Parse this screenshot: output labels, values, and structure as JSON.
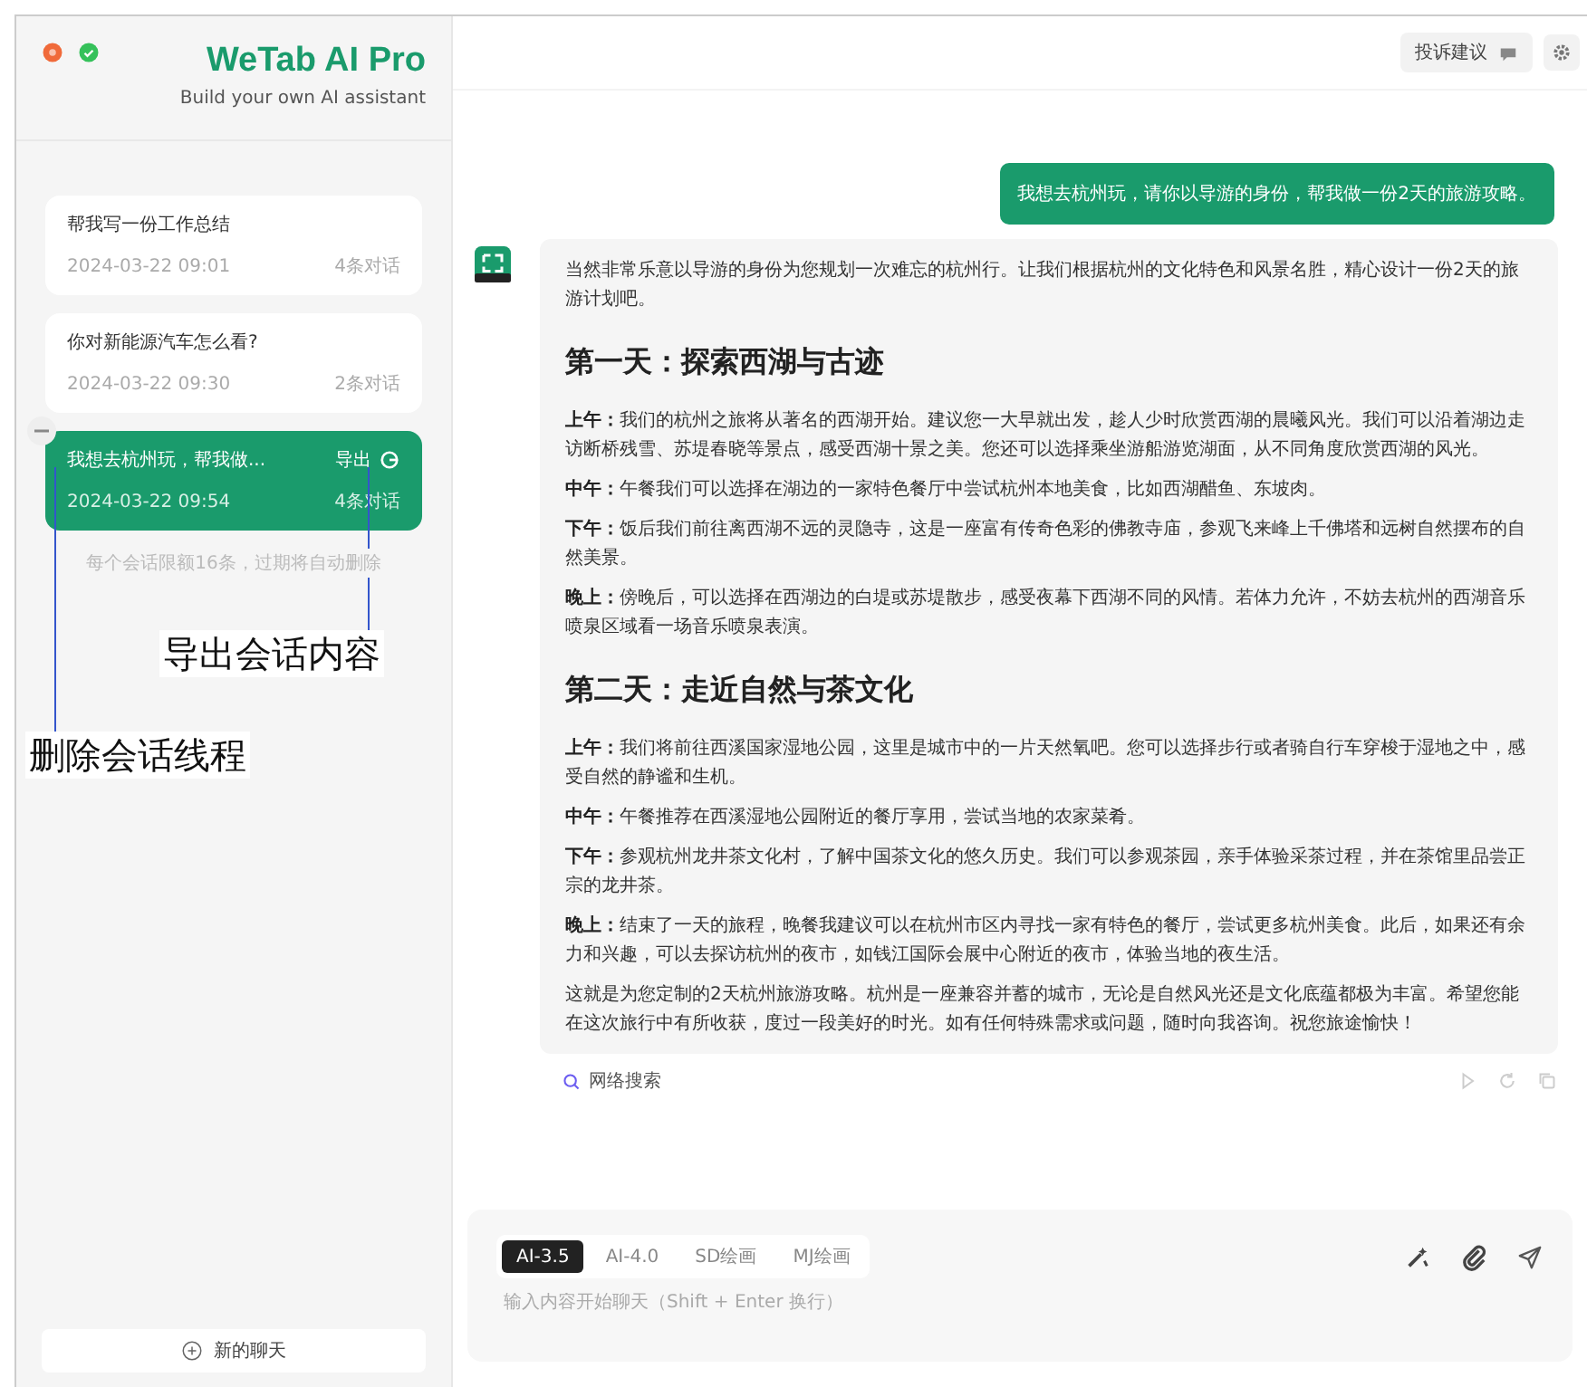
{
  "app": {
    "title": "WeTab AI Pro",
    "subtitle": "Build your own AI assistant"
  },
  "conversations": [
    {
      "title": "帮我写一份工作总结",
      "time": "2024-03-22 09:01",
      "count": "4条对话",
      "selected": false
    },
    {
      "title": "你对新能源汽车怎么看?",
      "time": "2024-03-22 09:30",
      "count": "2条对话",
      "selected": false
    },
    {
      "title": "我想去杭州玩，帮我做...",
      "time": "2024-03-22 09:54",
      "count": "4条对话",
      "selected": true,
      "export_label": "导出"
    }
  ],
  "limit_note": "每个会话限额16条，过期将自动删除",
  "new_chat": "新的聊天",
  "feedback_button": "投诉建议",
  "user_message": "我想去杭州玩，请你以导游的身份，帮我做一份2天的旅游攻略。",
  "answer": [
    {
      "kind": "text",
      "text": "当然非常乐意以导游的身份为您规划一次难忘的杭州行。让我们根据杭州的文化特色和风景名胜，精心设计一份2天的旅游计划吧。"
    },
    {
      "kind": "heading",
      "text": "第一天：探索西湖与古迹"
    },
    {
      "kind": "text",
      "text": "**上午：**我们的杭州之旅将从著名的西湖开始。建议您一大早就出发，趁人少时欣赏西湖的晨曦风光。我们可以沿着湖边走访断桥残雪、苏堤春晓等景点，感受西湖十景之美。您还可以选择乘坐游船游览湖面，从不同角度欣赏西湖的风光。"
    },
    {
      "kind": "text",
      "text": "**中午：**午餐我们可以选择在湖边的一家特色餐厅中尝试杭州本地美食，比如西湖醋鱼、东坡肉。"
    },
    {
      "kind": "text",
      "text": "**下午：**饭后我们前往离西湖不远的灵隐寺，这是一座富有传奇色彩的佛教寺庙，参观飞来峰上千佛塔和远树自然摆布的自然美景。"
    },
    {
      "kind": "text",
      "text": "**晚上：**傍晚后，可以选择在西湖边的白堤或苏堤散步，感受夜幕下西湖不同的风情。若体力允许，不妨去杭州的西湖音乐喷泉区域看一场音乐喷泉表演。"
    },
    {
      "kind": "heading",
      "text": "第二天：走近自然与茶文化"
    },
    {
      "kind": "text",
      "text": "**上午：**我们将前往西溪国家湿地公园，这里是城市中的一片天然氧吧。您可以选择步行或者骑自行车穿梭于湿地之中，感受自然的静谧和生机。"
    },
    {
      "kind": "text",
      "text": "**中午：**午餐推荐在西溪湿地公园附近的餐厅享用，尝试当地的农家菜肴。"
    },
    {
      "kind": "text",
      "text": "**下午：**参观杭州龙井茶文化村，了解中国茶文化的悠久历史。我们可以参观茶园，亲手体验采茶过程，并在茶馆里品尝正宗的龙井茶。"
    },
    {
      "kind": "text",
      "text": "**晚上：**结束了一天的旅程，晚餐我建议可以在杭州市区内寻找一家有特色的餐厅，尝试更多杭州美食。此后，如果还有余力和兴趣，可以去探访杭州的夜市，如钱江国际会展中心附近的夜市，体验当地的夜生活。"
    },
    {
      "kind": "text",
      "text": "这就是为您定制的2天杭州旅游攻略。杭州是一座兼容并蓄的城市，无论是自然风光还是文化底蕴都极为丰富。希望您能在这次旅行中有所收获，度过一段美好的时光。如有任何特殊需求或问题，随时向我咨询。祝您旅途愉快！"
    }
  ],
  "web_search": "网络搜索",
  "models": [
    {
      "label": "AI-3.5",
      "selected": true
    },
    {
      "label": "AI-4.0",
      "selected": false
    },
    {
      "label": "SD绘画",
      "selected": false
    },
    {
      "label": "MJ绘画",
      "selected": false
    }
  ],
  "input": {
    "placeholder": "输入内容开始聊天（Shift + Enter 换行）"
  },
  "annotations": [
    {
      "text": "导出会话内容"
    },
    {
      "text": "删除会话线程"
    }
  ]
}
